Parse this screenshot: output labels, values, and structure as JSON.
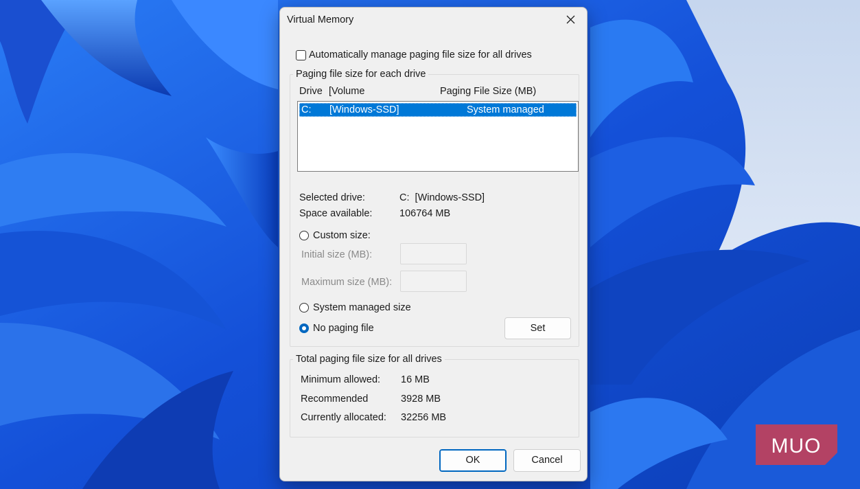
{
  "dialog": {
    "title": "Virtual Memory",
    "auto_manage_label": "Automatically manage paging file size for all drives",
    "auto_manage_checked": false
  },
  "per_drive": {
    "group_label": "Paging file size for each drive",
    "columns": {
      "drive": "Drive",
      "volume": "[Volume",
      "size": "Paging File Size (MB)"
    },
    "rows": [
      {
        "drive": "C:",
        "volume": "[Windows-SSD]",
        "size": "System managed",
        "selected": true
      }
    ],
    "selected_drive_label": "Selected drive:",
    "selected_drive_value": "C:  [Windows-SSD]",
    "space_label": "Space available:",
    "space_value": "106764 MB",
    "custom_size_label": "Custom size:",
    "initial_size_label": "Initial size (MB):",
    "initial_size_value": "",
    "max_size_label": "Maximum size (MB):",
    "max_size_value": "",
    "system_managed_label": "System managed size",
    "no_paging_label": "No paging file",
    "selected_option": "no-paging-file",
    "set_button": "Set"
  },
  "totals": {
    "group_label": "Total paging file size for all drives",
    "minimum_label": "Minimum allowed:",
    "minimum_value": "16 MB",
    "recommended_label": "Recommended",
    "recommended_value": "3928 MB",
    "allocated_label": "Currently allocated:",
    "allocated_value": "32256 MB"
  },
  "buttons": {
    "ok": "OK",
    "cancel": "Cancel"
  },
  "watermark": {
    "text": "MUO",
    "color": "#c0405a"
  },
  "colors": {
    "accent": "#0067c0",
    "selection": "#0078d7",
    "wallpaper": "#1b5fe0"
  }
}
